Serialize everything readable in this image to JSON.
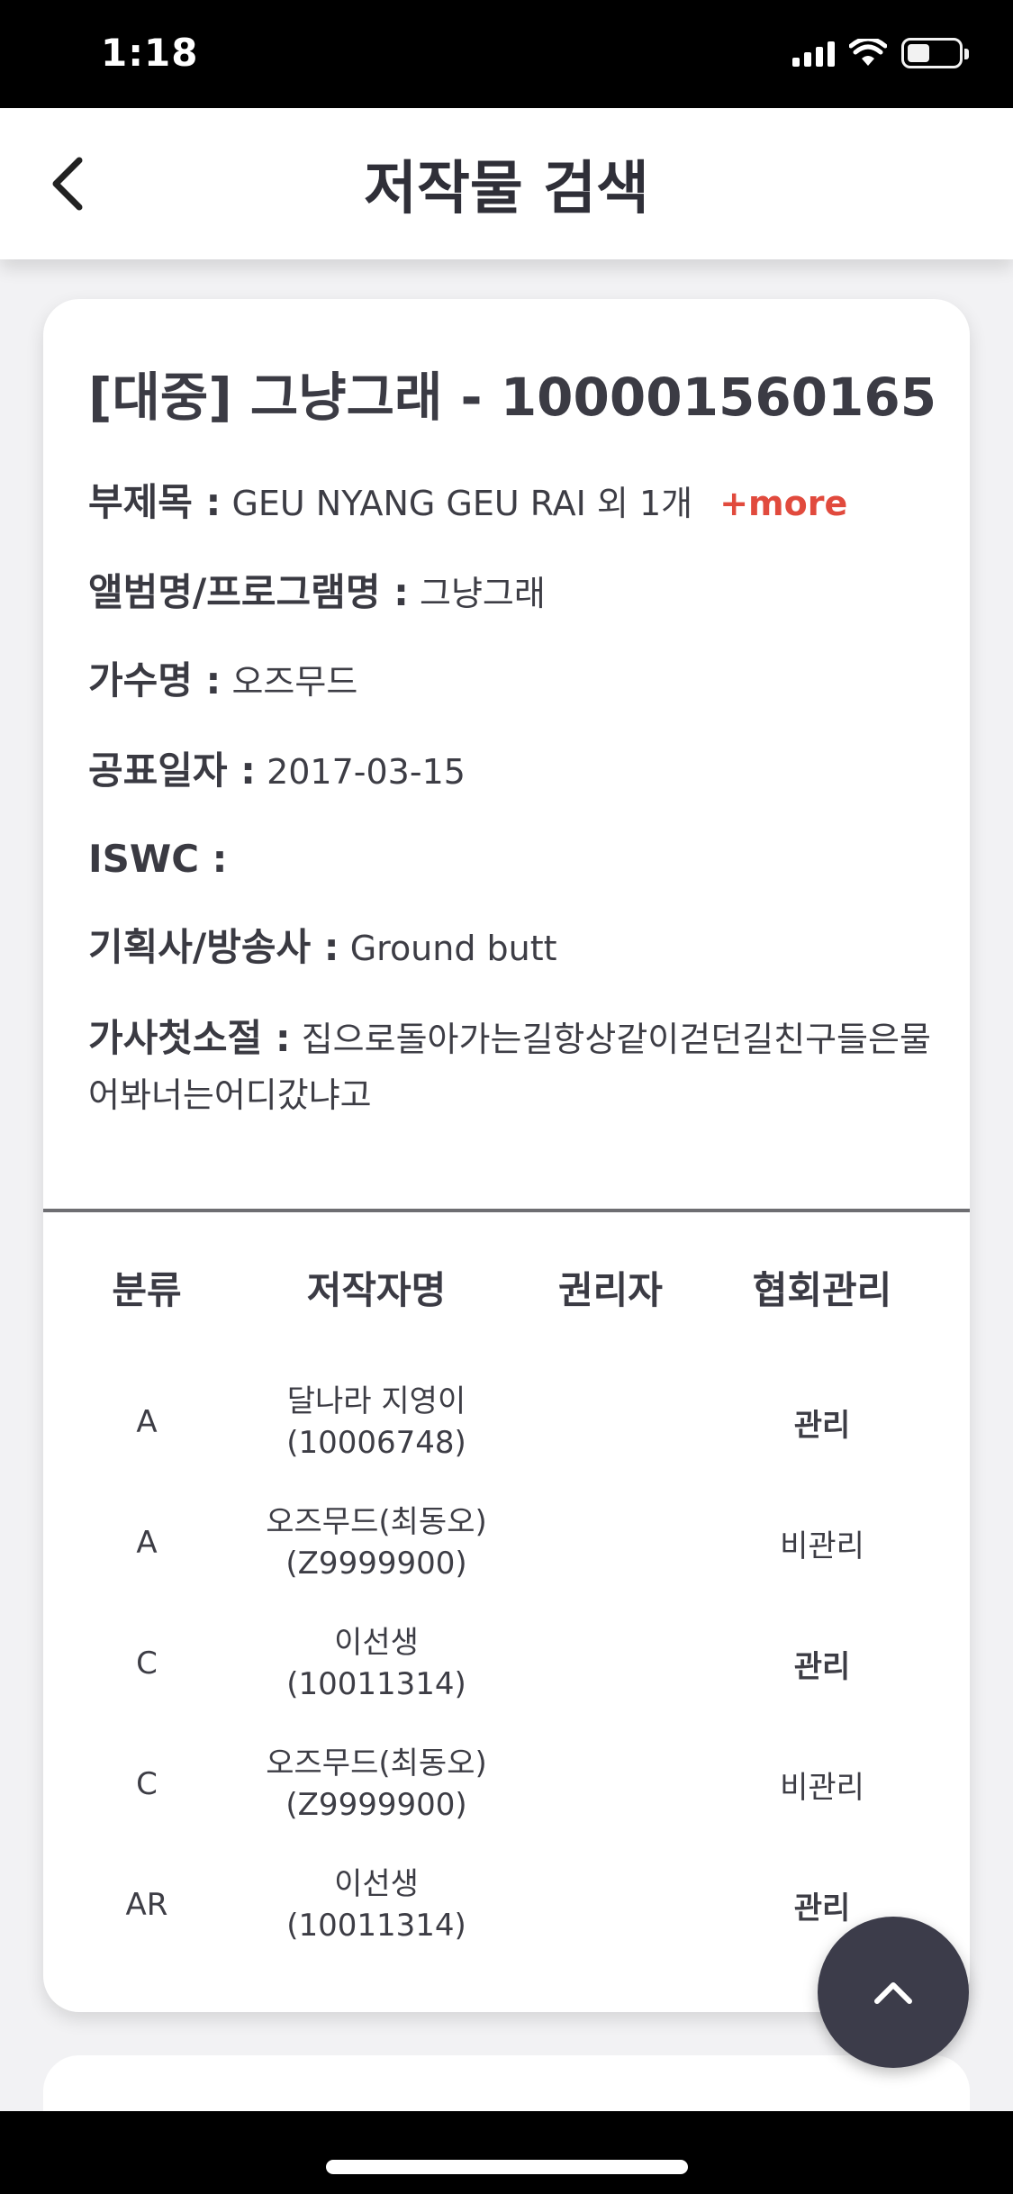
{
  "status_bar": {
    "time": "1:18"
  },
  "nav": {
    "title": "저작물 검색"
  },
  "work": {
    "title": "[대중] 그냥그래 - 100001560165",
    "subtitle_label": "부제목 :",
    "subtitle_value": "GEU NYANG GEU RAI 외 1개",
    "more_label": "+more",
    "album_label": "앨범명/프로그램명 :",
    "album_value": "그냥그래",
    "singer_label": "가수명 :",
    "singer_value": "오즈무드",
    "release_label": "공표일자 :",
    "release_value": "2017-03-15",
    "iswc_label": "ISWC :",
    "iswc_value": "",
    "agency_label": "기획사/방송사 :",
    "agency_value": "Ground butt",
    "lyric_label": "가사첫소절 :",
    "lyric_value": "집으로돌아가는길항상같이걷던길친구들은물어봐너는어디갔냐고"
  },
  "table": {
    "headers": [
      "분류",
      "저작자명",
      "권리자",
      "협회관리"
    ],
    "rows": [
      {
        "category": "A",
        "name_line1": "달나라 지영이",
        "name_line2": "(10006748)",
        "holder": "",
        "management": "관리"
      },
      {
        "category": "A",
        "name_line1": "오즈무드(최동오)",
        "name_line2": "(Z9999900)",
        "holder": "",
        "management": "비관리"
      },
      {
        "category": "C",
        "name_line1": "이선생",
        "name_line2": "(10011314)",
        "holder": "",
        "management": "관리"
      },
      {
        "category": "C",
        "name_line1": "오즈무드(최동오)",
        "name_line2": "(Z9999900)",
        "holder": "",
        "management": "비관리"
      },
      {
        "category": "AR",
        "name_line1": "이선생",
        "name_line2": "(10011314)",
        "holder": "",
        "management": "관리"
      }
    ]
  },
  "icons": {
    "back": "chevron-left-icon",
    "scroll_top": "chevron-up-icon",
    "wifi": "wifi-icon",
    "signal": "signal-icon",
    "battery": "battery-icon"
  },
  "colors": {
    "accent": "#e14a3d",
    "fab": "#3c3c4a",
    "text": "#3a3a42"
  }
}
